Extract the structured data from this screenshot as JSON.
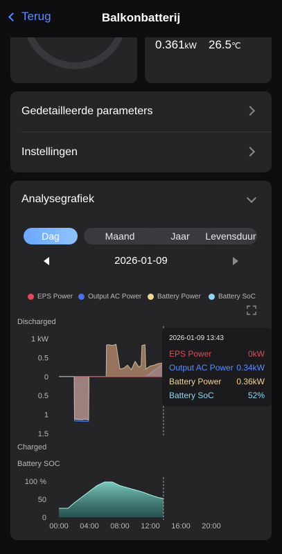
{
  "header": {
    "back_label": "Terug",
    "title": "Balkonbatterij"
  },
  "stats": {
    "power_value": "0.361",
    "power_unit": "kW",
    "temp_value": "26.5",
    "temp_unit": "℃"
  },
  "menu": {
    "items": [
      {
        "label": "Gedetailleerde parameters"
      },
      {
        "label": "Instellingen"
      }
    ]
  },
  "analysis": {
    "title": "Analysegrafiek",
    "tabs": [
      {
        "label": "Dag",
        "active": true
      },
      {
        "label": "Maand"
      },
      {
        "label": "Jaar"
      },
      {
        "label": "Levensduur"
      }
    ],
    "date": "2026-01-09",
    "legend": [
      {
        "name": "EPS Power",
        "color": "#e0485a"
      },
      {
        "name": "Output AC Power",
        "color": "#4a72e8"
      },
      {
        "name": "Battery Power",
        "color": "#f2d58c"
      },
      {
        "name": "Battery SoC",
        "color": "#8ed6f4"
      }
    ],
    "tooltip": {
      "time": "2026-01-09 13:43",
      "rows": [
        {
          "name": "EPS Power",
          "value": "0kW",
          "color": "#e0485a"
        },
        {
          "name": "Output AC Power",
          "value": "0.34kW",
          "color": "#5a8cff"
        },
        {
          "name": "Battery Power",
          "value": "0.36kW",
          "color": "#f2d58c"
        },
        {
          "name": "Battery SoC",
          "value": "52%",
          "color": "#8ed6f4"
        }
      ]
    }
  },
  "chart_data": [
    {
      "type": "area",
      "top_label": "Discharged",
      "bottom_label": "Charged",
      "y_tick_labels": [
        "1 kW",
        "0.5",
        "0",
        "0.5",
        "1",
        "1.5"
      ],
      "ylim": [
        -1.5,
        1
      ],
      "x_unit": "hour",
      "series": [
        {
          "name": "Battery Power",
          "x": [
            0,
            1,
            2,
            2.05,
            3,
            3.4,
            3.9,
            3.95,
            4.5,
            5,
            5.5,
            6,
            6.2,
            6.25,
            6.5,
            7,
            7.5,
            8,
            8.5,
            9,
            9.5,
            10,
            10.5,
            10.8,
            10.9,
            11.3,
            11.4,
            12,
            12.5,
            13,
            13.72
          ],
          "y": [
            0,
            0,
            0,
            -1.12,
            -1.14,
            -1.12,
            -1.14,
            0,
            0,
            0,
            0,
            0,
            0,
            0.83,
            0.84,
            0.82,
            0.85,
            0.2,
            0.22,
            0.3,
            0.18,
            0.4,
            0.25,
            0.3,
            0.82,
            0.84,
            0.2,
            0.28,
            0.3,
            0.34,
            0.36
          ]
        },
        {
          "name": "Output AC Power",
          "x": [
            0,
            1,
            2,
            2.05,
            3,
            3.9,
            3.95,
            6.2,
            6.25,
            8,
            10.8,
            10.9,
            11.4,
            13.72
          ],
          "y": [
            0,
            0,
            0,
            -1.17,
            -1.18,
            -1.18,
            0,
            0,
            0,
            0,
            0,
            0,
            0,
            0.34
          ]
        }
      ]
    },
    {
      "type": "area",
      "title": "Battery SOC",
      "y_tick_labels": [
        "100 %",
        "50",
        "0"
      ],
      "ylim": [
        0,
        100
      ],
      "x_tick_labels": [
        "00:00",
        "04:00",
        "08:00",
        "12:00",
        "16:00",
        "20:00"
      ],
      "series": [
        {
          "name": "Battery SoC",
          "x": [
            0,
            1.2,
            2,
            3,
            4,
            5,
            6,
            7,
            8,
            9,
            10,
            11,
            12,
            13,
            13.72
          ],
          "y": [
            25,
            25,
            40,
            56,
            72,
            88,
            98,
            98,
            88,
            82,
            76,
            70,
            62,
            55,
            52
          ]
        }
      ]
    }
  ]
}
